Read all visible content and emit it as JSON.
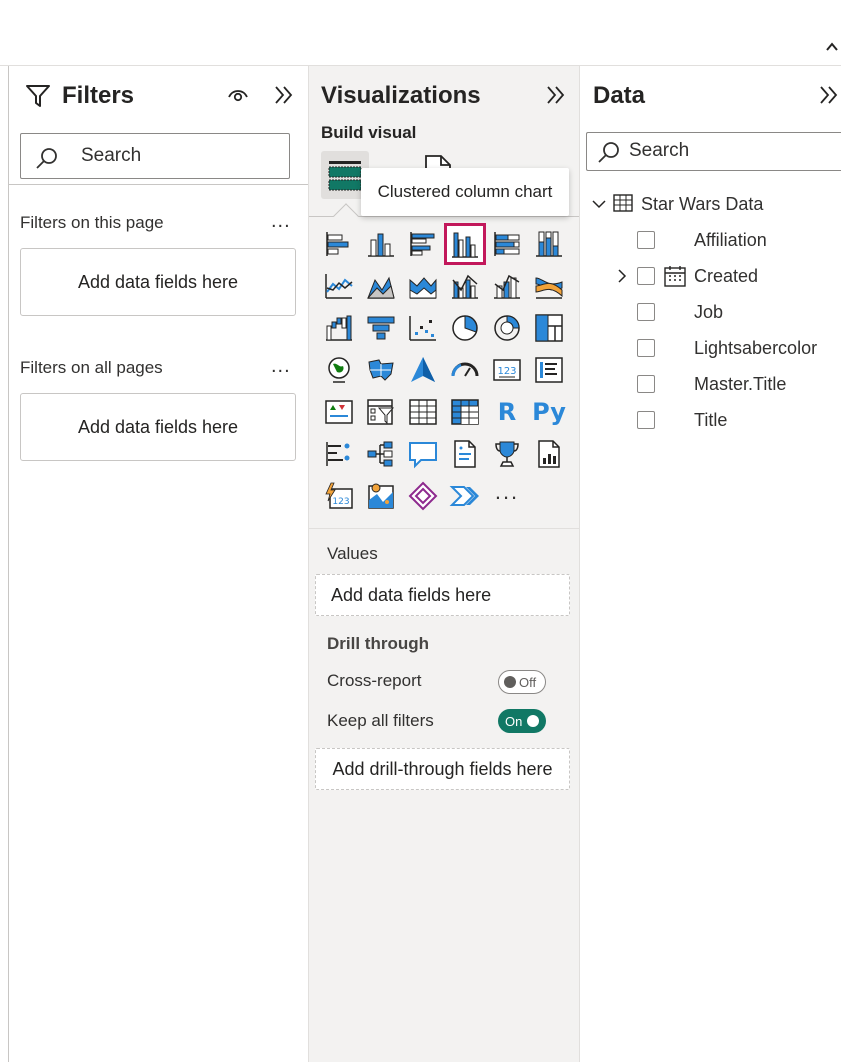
{
  "filters": {
    "title": "Filters",
    "search_placeholder": "Search",
    "on_this_page_label": "Filters on this page",
    "on_all_pages_label": "Filters on all pages",
    "more": "...",
    "add_fields_page": "Add data fields here",
    "add_fields_all": "Add data fields here"
  },
  "visualizations": {
    "title": "Visualizations",
    "build_visual_label": "Build visual",
    "tooltip": "Clustered column chart",
    "selected_icon": "clustered-column-chart-icon",
    "icons": [
      "stacked-bar-chart-icon",
      "stacked-column-chart-icon",
      "clustered-bar-chart-icon",
      "clustered-column-chart-icon",
      "100-stacked-bar-chart-icon",
      "100-stacked-column-chart-icon",
      "line-chart-icon",
      "area-chart-icon",
      "stacked-area-chart-icon",
      "line-clustered-column-chart-icon",
      "line-stacked-column-chart-icon",
      "ribbon-chart-icon",
      "waterfall-chart-icon",
      "funnel-chart-icon",
      "scatter-chart-icon",
      "pie-chart-icon",
      "donut-chart-icon",
      "treemap-icon",
      "map-icon",
      "filled-map-icon",
      "azure-map-icon",
      "gauge-icon",
      "card-icon",
      "multi-row-card-icon",
      "kpi-icon",
      "slicer-icon",
      "table-icon",
      "matrix-icon",
      "r-script-visual-icon",
      "python-visual-icon",
      "key-influencers-icon",
      "decomposition-tree-icon",
      "qa-icon",
      "smart-narrative-icon",
      "metrics-icon",
      "paginated-report-icon",
      "power-apps-icon",
      "arcgis-map-icon",
      "power-apps-diamond-icon",
      "power-automate-icon",
      "more-visuals-icon"
    ],
    "r_label": "R",
    "py_label": "Py",
    "more_label": "...",
    "values_label": "Values",
    "values_placeholder": "Add data fields here",
    "drill_through_label": "Drill through",
    "cross_report_label": "Cross-report",
    "cross_report_state": "Off",
    "keep_filters_label": "Keep all filters",
    "keep_filters_state": "On",
    "drill_placeholder": "Add drill-through fields here",
    "accent_color": "#117865",
    "selection_color": "#c2185b"
  },
  "data": {
    "title": "Data",
    "search_placeholder": "Search",
    "table_name": "Star Wars Data",
    "fields": [
      {
        "name": "Affiliation",
        "type": "field"
      },
      {
        "name": "Created",
        "type": "date-hierarchy"
      },
      {
        "name": "Job",
        "type": "field"
      },
      {
        "name": "Lightsabercolor",
        "type": "field"
      },
      {
        "name": "Master.Title",
        "type": "field"
      },
      {
        "name": "Title",
        "type": "field"
      }
    ]
  }
}
